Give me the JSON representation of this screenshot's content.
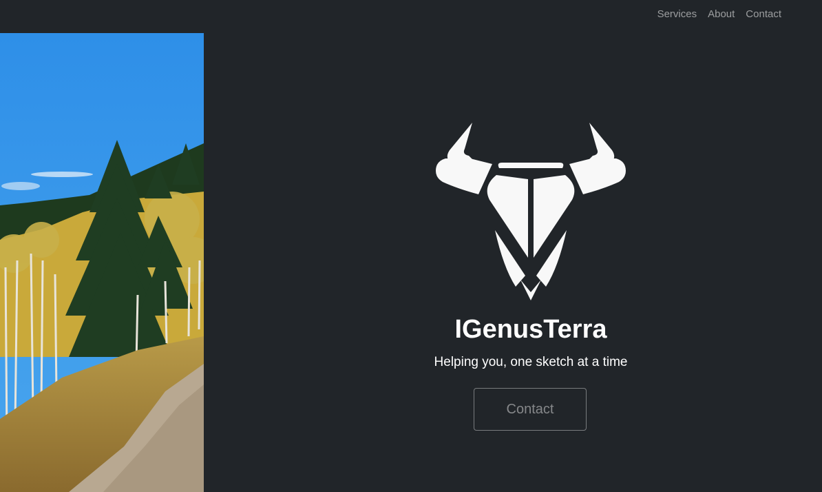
{
  "nav": {
    "links": [
      {
        "label": "Services"
      },
      {
        "label": "About"
      },
      {
        "label": "Contact"
      }
    ]
  },
  "hero": {
    "title": "IGenusTerra",
    "subtitle": "Helping you, one sketch at a time",
    "button_label": "Contact",
    "logo_icon": "bull-head-icon"
  },
  "colors": {
    "background": "#212529",
    "logo": "#f8f8f8",
    "nav_link": "#9a9c9e"
  }
}
